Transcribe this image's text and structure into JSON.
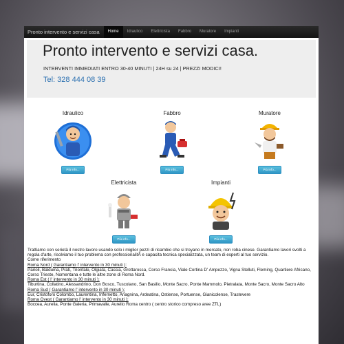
{
  "navbar": {
    "brand": "Pronto intervento e servizi casa",
    "links": [
      "Home",
      "Idraulico",
      "Elettricista",
      "Fabbro",
      "Muratore",
      "Impianti"
    ],
    "active": "Home"
  },
  "jumbotron": {
    "title": "Pronto intervento e servizi casa.",
    "subtitle": "INTERVENTI IMMEDIATI ENTRO 30-40 MINUTI | 24H su 24 | PREZZI MODICI!",
    "phone": "Tel: 328 444 08 39"
  },
  "services": [
    {
      "title": "Idraulico",
      "button": "Più info...",
      "icon": "plumber-icon"
    },
    {
      "title": "Fabbro",
      "button": "Più info...",
      "icon": "locksmith-icon"
    },
    {
      "title": "Muratore",
      "button": "Più info...",
      "icon": "mason-icon"
    },
    {
      "title": "Elettricista",
      "button": "Più info...",
      "icon": "electrician-icon"
    },
    {
      "title": "Impianti",
      "button": "Più info...",
      "icon": "installer-icon"
    }
  ],
  "content": {
    "intro": "Trattiamo con serietà il nostro lavoro usando solo i miglior pezzi di ricambio che si troyano in mercato, non roba cinese. Garantiamo lavori svolti a regola d'arte, risolviamo il tuo problema con professionalitÃ e capacita tecnica specializzata, un team di esperti al tuo servizio.",
    "come_riferimento": "Come riferimento",
    "zones": [
      {
        "heading": "Roma Nord ( Garantiamo l' intervento in 30 minuti ):",
        "areas": "Parioli, Balduina, Prati, Trionfale, Olgiata, Cassia, Grottarossa, Corso Francia, Viale Cortina D' Ampezzo, Vigna Stelluti, Fleming, Quartiere Africano, Corso Trieste, Nomentana e tutte le altre zone di Roma Nord."
      },
      {
        "heading": "Roma Est ( l' intervento in 30 minuti ):",
        "areas": "Tiburtina, Collatino, Alessandrino, Don Bosco, Tuscolano, San Basilio, Monte Sacro, Ponte Mammolo, Pietralata, Monte Sacro, Monte Sacro Alto"
      },
      {
        "heading": "Roma Sud ( Garantiamo l' intervento in 30 minuti ):",
        "areas": "Eur, Cristoforo Colombo, Laurentina, Infernetto, Anagnina, Ardeatina, Ostiense, Portuense, Gianicolense, Trastevere"
      },
      {
        "heading": "Roma Ovest ( Garantiamo l' intervento in 30 minuti ):",
        "areas": "Boccea, Aurelia, Ponte Galeria, Primavalle, Aurelio Roma centro ( centro storico compreso aree ZTL)"
      }
    ]
  },
  "colors": {
    "navbar": "#1b1b1b",
    "link": "#2a6fb0",
    "button": "#3aa6d6",
    "jumbotron": "#eeeeee"
  }
}
